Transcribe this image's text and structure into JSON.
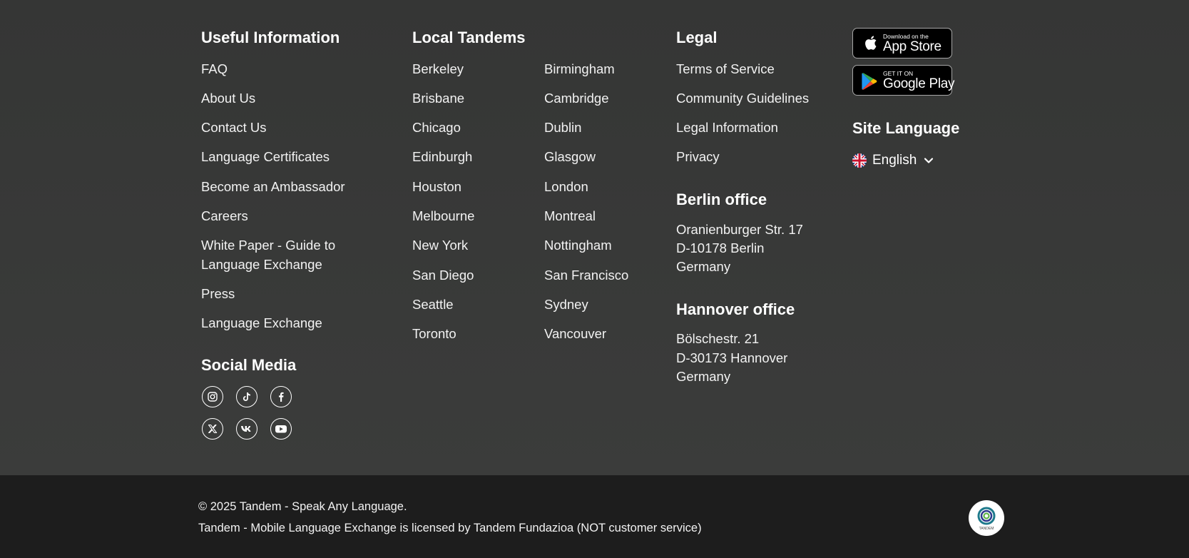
{
  "useful_information": {
    "heading": "Useful Information",
    "links": [
      "FAQ",
      "About Us",
      "Contact Us",
      "Language Certificates",
      "Become an Ambassador",
      "Careers",
      "White Paper - Guide to",
      "Language Exchange",
      "Press",
      "Language Exchange"
    ]
  },
  "social_media": {
    "heading": "Social Media",
    "icons": [
      "instagram-icon",
      "tiktok-icon",
      "facebook-icon",
      "x-icon",
      "vk-icon",
      "youtube-icon"
    ]
  },
  "local_tandems": {
    "heading": "Local Tandems",
    "col1": [
      "Berkeley",
      "Brisbane",
      "Chicago",
      "Edinburgh",
      "Houston",
      "Melbourne",
      "New York",
      "San Diego",
      "Seattle",
      "Toronto"
    ],
    "col2": [
      "Birmingham",
      "Cambridge",
      "Dublin",
      "Glasgow",
      "London",
      "Montreal",
      "Nottingham",
      "San Francisco",
      "Sydney",
      "Vancouver"
    ]
  },
  "legal": {
    "heading": "Legal",
    "links": [
      "Terms of Service",
      "Community Guidelines",
      "Legal Information",
      "Privacy"
    ]
  },
  "berlin_office": {
    "heading": "Berlin office",
    "lines": [
      "Oranienburger Str. 17",
      "D-10178 Berlin",
      "Germany"
    ]
  },
  "hannover_office": {
    "heading": "Hannover office",
    "lines": [
      "Bölschestr. 21",
      "D-30173 Hannover",
      "Germany"
    ]
  },
  "app_store": {
    "small": "Download on the",
    "big": "App Store"
  },
  "google_play": {
    "small": "GET IT ON",
    "big": "Google Play"
  },
  "site_language": {
    "heading": "Site Language",
    "selected": "English",
    "flag": "uk-flag-icon"
  },
  "bottom": {
    "copyright": "© 2025 Tandem - Speak Any Language.",
    "license": "Tandem - Mobile Language Exchange is licensed by Tandem Fundazioa (NOT customer service)",
    "logo_text": "TANDEM"
  },
  "colors": {
    "main_bg": "#383938",
    "bottom_bg": "#1d1d1d",
    "text": "#ffffff"
  }
}
